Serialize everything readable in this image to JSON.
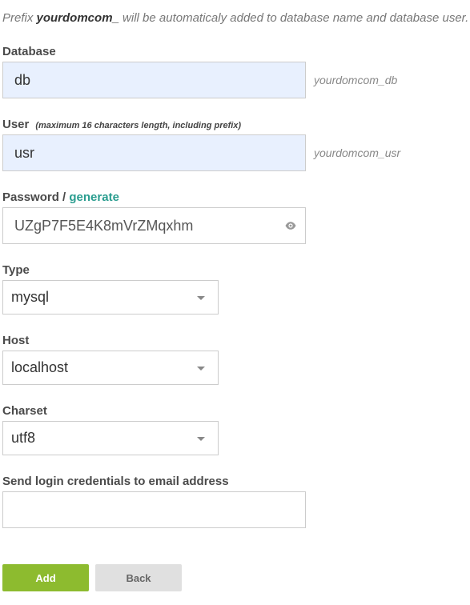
{
  "prefix_note": {
    "before": "Prefix ",
    "prefix": "yourdomcom_",
    "after": " will be automaticaly added to database name and database user."
  },
  "database": {
    "label": "Database",
    "value": "db",
    "suffix": "yourdomcom_db"
  },
  "user": {
    "label": "User",
    "hint": "(maximum 16 characters length, including prefix)",
    "value": "usr",
    "suffix": "yourdomcom_usr"
  },
  "password": {
    "label": "Password",
    "separator": " / ",
    "generate_label": "generate",
    "value": "UZgP7F5E4K8mVrZMqxhm",
    "toggle_icon": "eye-icon"
  },
  "type": {
    "label": "Type",
    "selected": "mysql"
  },
  "host": {
    "label": "Host",
    "selected": "localhost"
  },
  "charset": {
    "label": "Charset",
    "selected": "utf8"
  },
  "email": {
    "label": "Send login credentials to email address",
    "value": ""
  },
  "actions": {
    "add_label": "Add",
    "back_label": "Back"
  },
  "colors": {
    "accent": "#2a9d8f",
    "add_button": "#8dbb2f",
    "back_button": "#e0e0e0",
    "autofill_background": "#e8f0fe"
  }
}
